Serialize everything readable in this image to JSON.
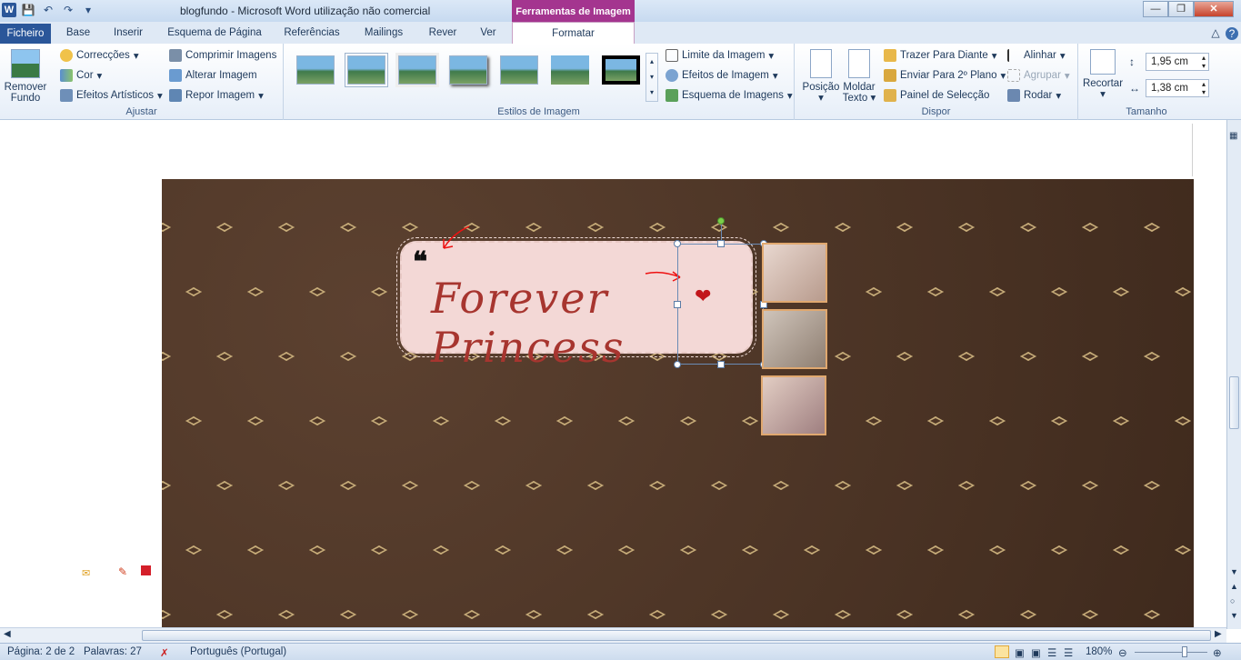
{
  "window": {
    "document_name": "blogfundo",
    "separator": "-",
    "app_title": "Microsoft Word utilização não comercial",
    "context_tab_group": "Ferramentas de Imagem"
  },
  "qat": {
    "app_icon_letter": "W",
    "save_icon": "save-icon",
    "undo_icon": "undo-icon",
    "redo_icon": "redo-icon"
  },
  "tabs": [
    "Ficheiro",
    "Base",
    "Inserir",
    "Esquema de Página",
    "Referências",
    "Mailings",
    "Rever",
    "Ver",
    "Formatar"
  ],
  "ribbon": {
    "adjust": {
      "label": "Ajustar",
      "remove_bg": "Remover Fundo",
      "corrections": "Correcções",
      "color": "Cor",
      "artistic": "Efeitos Artísticos",
      "compress": "Comprimir Imagens",
      "change": "Alterar Imagem",
      "reset": "Repor Imagem"
    },
    "styles": {
      "label": "Estilos de Imagem",
      "border": "Limite da Imagem",
      "effects": "Efeitos de Imagem",
      "layout": "Esquema de Imagens"
    },
    "arrange": {
      "label": "Dispor",
      "position": "Posição",
      "wrap_line1": "Moldar",
      "wrap_line2": "Texto",
      "bring_forward": "Trazer Para Diante",
      "send_backward": "Enviar Para 2º Plano",
      "selection_pane": "Painel de Selecção",
      "align": "Alinhar",
      "group": "Agrupar",
      "rotate": "Rodar"
    },
    "size": {
      "label": "Tamanho",
      "crop": "Recortar",
      "height": "1,95 cm",
      "width": "1,38 cm"
    }
  },
  "document": {
    "quote_mark": "❝",
    "banner_title": "Forever Princess"
  },
  "status": {
    "page": "Página: 2 de 2",
    "words": "Palavras: 27",
    "language": "Português (Portugal)",
    "zoom": "180%"
  }
}
